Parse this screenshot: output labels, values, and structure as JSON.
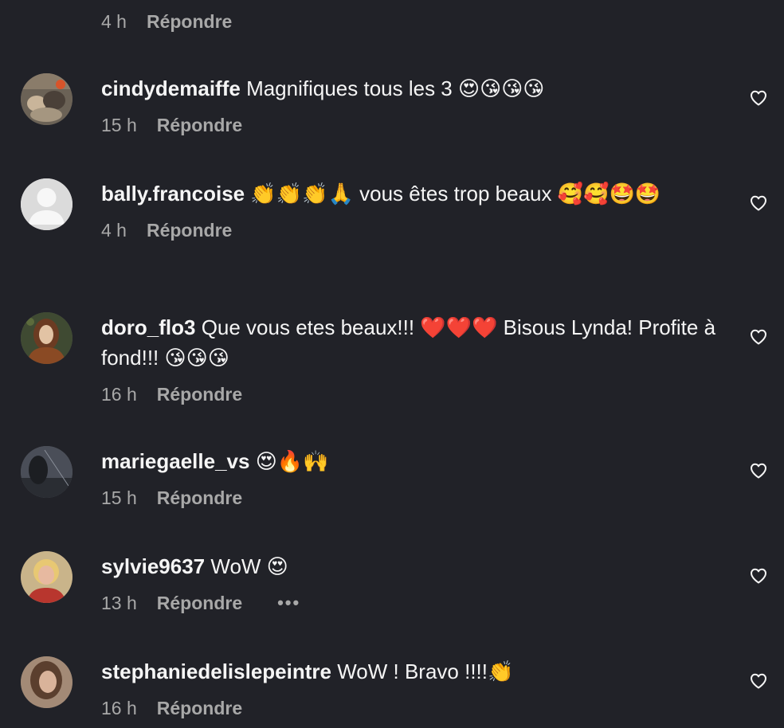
{
  "top": {
    "time": "4 h",
    "reply_label": "Répondre"
  },
  "comments": [
    {
      "username": "cindydemaiffe",
      "text": "Magnifiques tous les 3 😍😘😘😘",
      "time": "15 h",
      "reply_label": "Répondre"
    },
    {
      "username": "bally.francoise",
      "text": "👏👏👏🙏 vous êtes trop beaux 🥰🥰🤩🤩",
      "time": "4 h",
      "reply_label": "Répondre"
    },
    {
      "username": "doro_flo3",
      "text": "Que vous etes beaux!!! ❤️❤️❤️ Bisous Lynda! Profite à fond!!! 😘😘😘",
      "time": "16 h",
      "reply_label": "Répondre"
    },
    {
      "username": "mariegaelle_vs",
      "text": "😍🔥🙌",
      "time": "15 h",
      "reply_label": "Répondre"
    },
    {
      "username": "sylvie9637",
      "text": "WoW 😍",
      "time": "13 h",
      "reply_label": "Répondre",
      "more_label": "•••"
    },
    {
      "username": "stephaniedelislepeintre",
      "text": "WoW ! Bravo !!!!👏",
      "time": "16 h",
      "reply_label": "Répondre"
    }
  ],
  "icons": {
    "like": "heart-icon",
    "avatar_placeholder": "default-user-icon"
  },
  "colors": {
    "background": "#212228",
    "text": "#f5f5f5",
    "secondary": "#a8a8a8"
  }
}
